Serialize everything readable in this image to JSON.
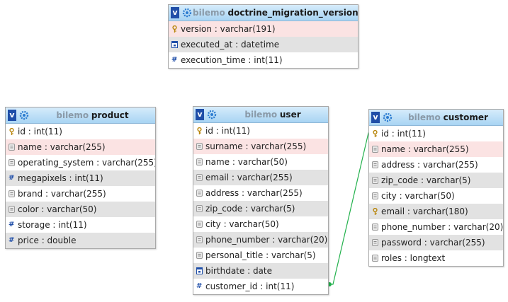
{
  "sep": " : ",
  "tables": {
    "migrations": {
      "db": "bilemo",
      "name": "doctrine_migration_versions",
      "columns": [
        {
          "name": "version",
          "type": "varchar(191)",
          "icon": "key-icon"
        },
        {
          "name": "executed_at",
          "type": "datetime",
          "icon": "date-icon"
        },
        {
          "name": "execution_time",
          "type": "int(11)",
          "icon": "number-icon"
        }
      ]
    },
    "product": {
      "db": "bilemo",
      "name": "product",
      "columns": [
        {
          "name": "id",
          "type": "int(11)",
          "icon": "key-icon"
        },
        {
          "name": "name",
          "type": "varchar(255)",
          "icon": "text-icon"
        },
        {
          "name": "operating_system",
          "type": "varchar(255)",
          "icon": "text-icon"
        },
        {
          "name": "megapixels",
          "type": "int(11)",
          "icon": "number-icon"
        },
        {
          "name": "brand",
          "type": "varchar(255)",
          "icon": "text-icon"
        },
        {
          "name": "color",
          "type": "varchar(50)",
          "icon": "text-icon"
        },
        {
          "name": "storage",
          "type": "int(11)",
          "icon": "number-icon"
        },
        {
          "name": "price",
          "type": "double",
          "icon": "number-icon"
        }
      ]
    },
    "user": {
      "db": "bilemo",
      "name": "user",
      "columns": [
        {
          "name": "id",
          "type": "int(11)",
          "icon": "key-icon"
        },
        {
          "name": "surname",
          "type": "varchar(255)",
          "icon": "text-icon"
        },
        {
          "name": "name",
          "type": "varchar(50)",
          "icon": "text-icon"
        },
        {
          "name": "email",
          "type": "varchar(255)",
          "icon": "text-icon"
        },
        {
          "name": "address",
          "type": "varchar(255)",
          "icon": "text-icon"
        },
        {
          "name": "zip_code",
          "type": "varchar(5)",
          "icon": "text-icon"
        },
        {
          "name": "city",
          "type": "varchar(50)",
          "icon": "text-icon"
        },
        {
          "name": "phone_number",
          "type": "varchar(20)",
          "icon": "text-icon"
        },
        {
          "name": "personal_title",
          "type": "varchar(5)",
          "icon": "text-icon"
        },
        {
          "name": "birthdate",
          "type": "date",
          "icon": "date-icon"
        },
        {
          "name": "customer_id",
          "type": "int(11)",
          "icon": "number-icon"
        }
      ]
    },
    "customer": {
      "db": "bilemo",
      "name": "customer",
      "columns": [
        {
          "name": "id",
          "type": "int(11)",
          "icon": "key-icon"
        },
        {
          "name": "name",
          "type": "varchar(255)",
          "icon": "text-icon"
        },
        {
          "name": "address",
          "type": "varchar(255)",
          "icon": "text-icon"
        },
        {
          "name": "zip_code",
          "type": "varchar(5)",
          "icon": "text-icon"
        },
        {
          "name": "city",
          "type": "varchar(50)",
          "icon": "text-icon"
        },
        {
          "name": "email",
          "type": "varchar(180)",
          "icon": "key-icon"
        },
        {
          "name": "phone_number",
          "type": "varchar(20)",
          "icon": "text-icon"
        },
        {
          "name": "password",
          "type": "varchar(255)",
          "icon": "text-icon"
        },
        {
          "name": "roles",
          "type": "longtext",
          "icon": "text-icon"
        }
      ]
    }
  },
  "colors": {
    "header_top": "#d6ecfb",
    "header_bottom": "#a8d4f3",
    "row_alt": "#e2e2e2",
    "row_highlight": "#fbe3e3",
    "relation_line": "#22b14c",
    "db_name": "#8a9aa8"
  }
}
